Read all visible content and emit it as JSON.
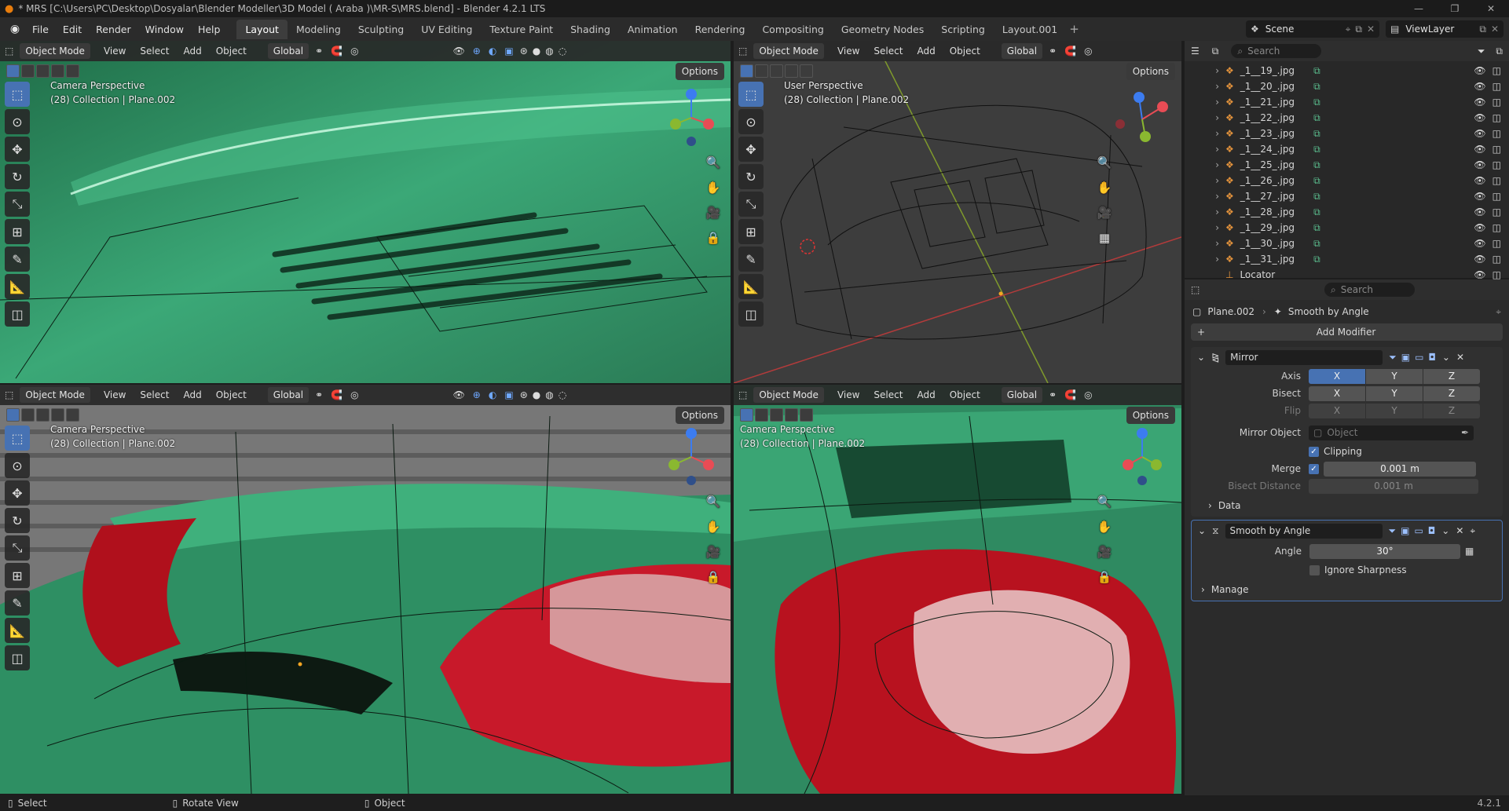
{
  "app": {
    "title": "* MRS [C:\\Users\\PC\\Desktop\\Dosyalar\\Blender Modeller\\3D Model ( Araba )\\MR-S\\MRS.blend] - Blender 4.2.1 LTS",
    "version": "4.2.1"
  },
  "menu": [
    "File",
    "Edit",
    "Render",
    "Window",
    "Help"
  ],
  "tabs": [
    "Layout",
    "Modeling",
    "Sculpting",
    "UV Editing",
    "Texture Paint",
    "Shading",
    "Animation",
    "Rendering",
    "Compositing",
    "Geometry Nodes",
    "Scripting",
    "Layout.001"
  ],
  "active_tab": "Layout",
  "scene": "Scene",
  "view_layer": "ViewLayer",
  "viewport_header": {
    "mode": "Object Mode",
    "menus": [
      "View",
      "Select",
      "Add",
      "Object"
    ],
    "orientation": "Global",
    "options": "Options"
  },
  "viewports": [
    {
      "view": "Camera Perspective",
      "info": "(28) Collection | Plane.002"
    },
    {
      "view": "User Perspective",
      "info": "(28) Collection | Plane.002"
    },
    {
      "view": "Camera Perspective",
      "info": "(28) Collection | Plane.002"
    },
    {
      "view": "Camera Perspective",
      "info": "(28) Collection | Plane.002"
    }
  ],
  "outliner": {
    "search_placeholder": "Search",
    "items": [
      "_1__19_.jpg",
      "_1__20_.jpg",
      "_1__21_.jpg",
      "_1__22_.jpg",
      "_1__23_.jpg",
      "_1__24_.jpg",
      "_1__25_.jpg",
      "_1__26_.jpg",
      "_1__27_.jpg",
      "_1__28_.jpg",
      "_1__29_.jpg",
      "_1__30_.jpg",
      "_1__31_.jpg",
      "Locator"
    ]
  },
  "properties": {
    "search_placeholder": "Search",
    "breadcrumb_object": "Plane.002",
    "breadcrumb_modifier": "Smooth by Angle",
    "add_modifier": "Add Modifier",
    "mirror": {
      "name": "Mirror",
      "axis_label": "Axis",
      "bisect_label": "Bisect",
      "flip_label": "Flip",
      "axes": [
        "X",
        "Y",
        "Z"
      ],
      "mirror_object_label": "Mirror Object",
      "mirror_object_placeholder": "Object",
      "clipping_label": "Clipping",
      "merge_label": "Merge",
      "merge_value": "0.001 m",
      "bisect_distance_label": "Bisect Distance",
      "bisect_distance_value": "0.001 m",
      "data_label": "Data"
    },
    "smooth": {
      "name": "Smooth by Angle",
      "angle_label": "Angle",
      "angle_value": "30°",
      "ignore_label": "Ignore Sharpness",
      "manage_label": "Manage"
    }
  },
  "status": {
    "select": "Select",
    "rotate": "Rotate View",
    "object": "Object"
  }
}
